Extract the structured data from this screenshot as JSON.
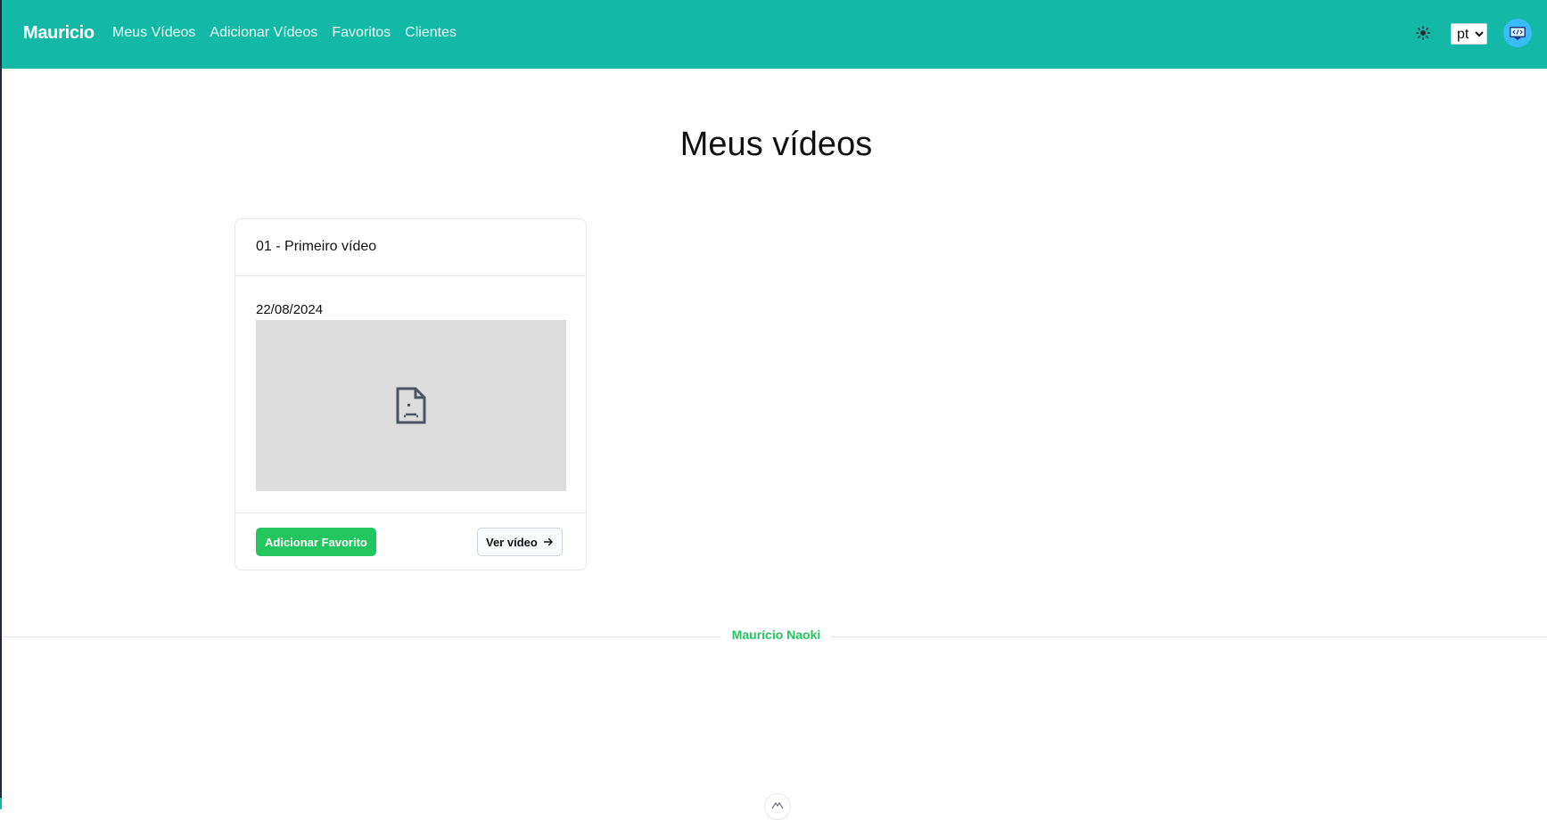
{
  "nav": {
    "brand": "Mauricio",
    "links": [
      "Meus Vídeos",
      "Adicionar Vídeos",
      "Favoritos",
      "Clientes"
    ],
    "language": {
      "selected": "pt",
      "options": [
        "pt"
      ]
    },
    "icons": {
      "theme": "sun-icon",
      "avatar": "code-window-icon"
    }
  },
  "main": {
    "title": "Meus vídeos",
    "cards": [
      {
        "title": "01 - Primeiro vídeo",
        "date": "22/08/2024",
        "video_icon": "broken-document-icon",
        "favorite_label": "Adicionar Favorito",
        "view_label": "Ver vídeo",
        "view_icon": "arrow-right-icon"
      }
    ]
  },
  "footer": {
    "name": "Maurício Naoki",
    "scroll_icon": "chevron-up-icon"
  },
  "colors": {
    "primary": "#14b8a6",
    "accent_green": "#22c55e"
  }
}
